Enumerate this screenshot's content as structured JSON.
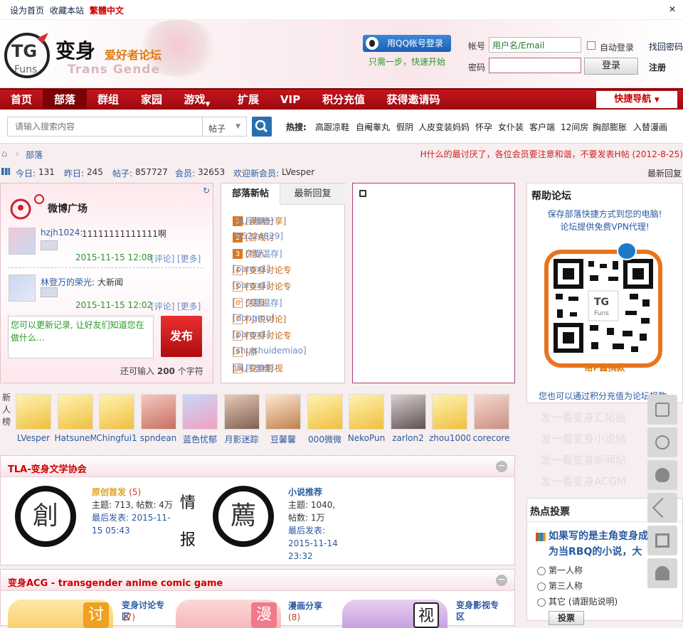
{
  "topbar": {
    "set_home": "设为首页",
    "bookmark": "收藏本站",
    "traditional": "繁體中文"
  },
  "header": {
    "logo_mark": "TG",
    "logo_mark2": "Funs",
    "site_title": "变身",
    "site_sub": "爱好者论坛",
    "site_en": "Trans Gende",
    "qq_login": "用QQ帐号登录",
    "qq_tip": "只需一步，快速开始",
    "account_label": "帐号",
    "account_placeholder": "用户名/Email",
    "password_label": "密码",
    "auto_login": "自动登录",
    "find_password": "找回密码",
    "login_button": "登录",
    "register": "注册"
  },
  "nav": {
    "items": [
      "首页",
      "部落",
      "群组",
      "家园",
      "游戏",
      "扩展",
      "VIP",
      "积分充值",
      "获得邀请码"
    ],
    "quick_nav": "快捷导航"
  },
  "search": {
    "placeholder": "请输入搜索内容",
    "type": "帖子",
    "hot_label": "热搜:",
    "hot_terms": [
      "高跟凉鞋",
      "自阉睾丸",
      "假阴",
      "人皮变装妈妈",
      "怀孕",
      "女仆装",
      "客户端",
      "12间房",
      "胸部膨胀",
      "入替漫画"
    ]
  },
  "breadcrumb": {
    "current": "部落"
  },
  "notice": "H什么的最讨厌了，各位会员要注意和谐，不要发表H帖 (2012-8-25)",
  "stats": {
    "today_label": "今日:",
    "today": "131",
    "yesterday_label": "昨日:",
    "yesterday": "245",
    "posts_label": "帖子:",
    "posts": "857727",
    "members_label": "会员:",
    "members": "32653",
    "welcome_label": "欢迎新会员:",
    "newest": "LVesper",
    "latest_reply": "最新回复"
  },
  "weibo": {
    "title": "微博广场",
    "entries": [
      {
        "name": "hzjh1024:",
        "text": "11111111111111啊",
        "time": "2015-11-15 12:08",
        "comment": "[评论]",
        "more": "[更多]"
      },
      {
        "name": "林登万的荣光:",
        "text": "大新闻",
        "time": "2015-11-15 12:02",
        "comment": "[评论]",
        "more": "[更多]"
      }
    ],
    "input_placeholder": "您可以更新记录, 让好友们知道您在做什么...",
    "publish": "发布",
    "remain_prefix": "还可输入",
    "remain_count": "200",
    "remain_suffix": "个字符"
  },
  "posts_tabs": {
    "tab_new": "部落新帖",
    "tab_reply": "最新回复",
    "items": [
      {
        "n": "1",
        "title": "[漫画分享]",
        "author": "[风月嗜嗜]"
      },
      {
        "n": "2",
        "title": "[游戏讨",
        "author": "[A5224829]"
      },
      {
        "n": "3",
        "title": "[猎人",
        "author": "[ ᐡ 夕夏温存]"
      },
      {
        "n": "4",
        "title": "[变身讨论专",
        "author": "[pansx1]"
      },
      {
        "n": "5",
        "title": "[变身讨论专",
        "author": "[pansx1]"
      },
      {
        "n": "6",
        "title": "[变身",
        "author": "[ ᐡ 夕夏温存]"
      },
      {
        "n": "7",
        "title": "[小说讨论]",
        "author": "[dongmu]"
      },
      {
        "n": "8",
        "title": "[变身讨论专",
        "author": "[pansx1]"
      },
      {
        "n": "9",
        "title": "[原",
        "author": "[shuishuidemiao]"
      },
      {
        "n": "10",
        "title": "[变身影视",
        "author": "[风月嗜嗜]"
      }
    ]
  },
  "help": {
    "title": "帮助论坛",
    "line1": "保存部落快捷方式到您的电脑!",
    "line2": "论坛提供免费VPN代理!",
    "qr_caption": "给P酱捐款",
    "footer": "您也可以通过积分充值为论坛捐款"
  },
  "new_members": {
    "label": "新人榜",
    "members": [
      "LVesper",
      "HatsuneM",
      "Chingfui1",
      "spndean",
      "蓝色忧郁",
      "月影迷踪",
      "豆馨馨",
      "000微微",
      "NekoPun",
      "zarlon2",
      "zhou1000",
      "corecore"
    ]
  },
  "section_tla": {
    "title": "TLA-变身文学协会",
    "forum1": {
      "name": "原创首发",
      "count": "(5)",
      "topics": "主题: 713, 帖数: 4万",
      "last": "最后发表: 2015-11-15 05:43"
    },
    "seal1": "創",
    "middle1": "情",
    "middle2": "报",
    "seal2": "薦",
    "forum2": {
      "name": "小说推荐",
      "topics": "主题: 1040, 帖数: 1万",
      "last": "最后发表: 2015-11-14 23:32"
    }
  },
  "section_acg": {
    "title": "变身ACG - transgender anime comic game",
    "forums": [
      {
        "name": "变身讨论专区",
        "count": "(7)",
        "badge": "讨"
      },
      {
        "name": "漫画分享",
        "count": "(8)",
        "badge": "漫"
      },
      {
        "name": "变身影视专区",
        "badge": "视"
      }
    ]
  },
  "vote": {
    "title": "热点投票",
    "question": "如果写的是主角变身成为当RBQ的小说，大",
    "options": [
      "第一人称",
      "第三人称",
      "其它 (请跟贴说明)"
    ],
    "submit": "投票"
  },
  "right_faded": [
    "发一看变身汇帖画",
    "发一看变身小说帖",
    "发一看变身新闻帖",
    "发一看变身ACGM"
  ]
}
